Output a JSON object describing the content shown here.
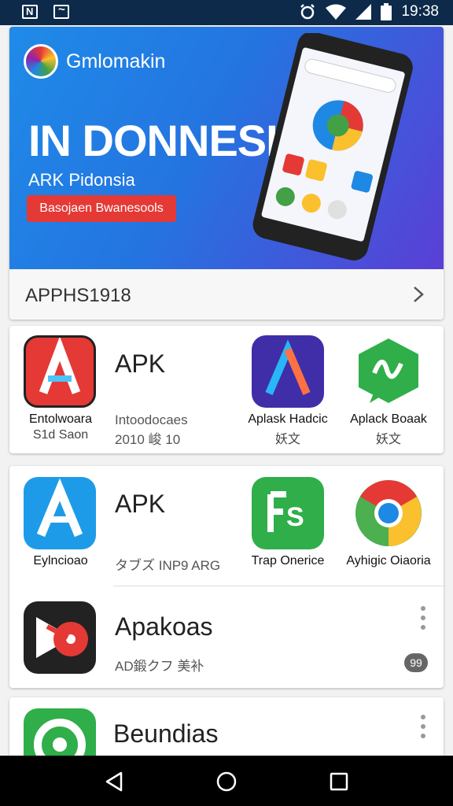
{
  "status_bar": {
    "time": "19:38",
    "icons": [
      "notification-n-icon",
      "notification-m-icon",
      "alarm-icon",
      "wifi-icon",
      "signal-icon",
      "battery-icon"
    ]
  },
  "banner": {
    "brand": "Gmlomakin",
    "headline": "IN DONNESIA",
    "subhead": "ARK Pidonsia",
    "cta": "Basojaen Bwanesools",
    "footer_label": "APPHS1918",
    "colors": {
      "gradient_start": "#1f8be8",
      "gradient_end": "#5a3fd6",
      "cta": "#e53935"
    }
  },
  "card1": {
    "featured": {
      "title": "APK",
      "subtitle_line1": "Intoodocaes",
      "subtitle_line2": "2010 峻 10",
      "caption_line1": "Entolwoara",
      "caption_line2": "S1d Saon",
      "icon": "apk-a-red-icon"
    },
    "apps": [
      {
        "name": "Aplask Hadcic",
        "sub": "妖文",
        "icon": "a-purple-icon"
      },
      {
        "name": "Aplack Boaak",
        "sub": "妖文",
        "icon": "green-chat-icon"
      }
    ]
  },
  "card2": {
    "featured": {
      "title": "APK",
      "subtitle": "タブズ INP9 ARG",
      "caption": "Eylncioao",
      "icon": "apk-a-blue-icon"
    },
    "apps": [
      {
        "name": "Trap Onerice",
        "icon": "fs-green-icon"
      },
      {
        "name": "Ayhigic Oiaoria",
        "icon": "chrome-icon"
      }
    ],
    "list_item": {
      "title": "Apakoas",
      "subtitle": "AD鍛クフ 美补",
      "icon": "music-record-icon",
      "badge": "99"
    }
  },
  "card3": {
    "list_item": {
      "title": "Beundias",
      "icon": "green-circle-icon"
    }
  },
  "nav_bar": {
    "buttons": [
      "back-icon",
      "home-icon",
      "recents-icon"
    ]
  }
}
